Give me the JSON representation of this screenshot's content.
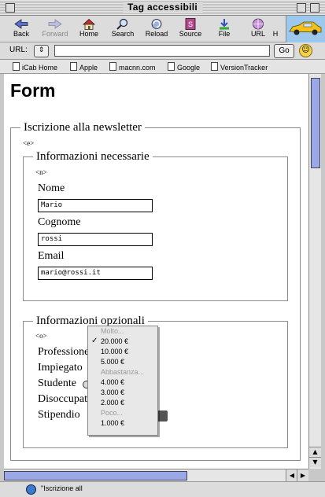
{
  "window": {
    "title": "Tag accessibili"
  },
  "toolbar": {
    "buttons": [
      {
        "label": "Back",
        "icon": "back-arrow-icon"
      },
      {
        "label": "Forward",
        "icon": "forward-arrow-icon"
      },
      {
        "label": "Home",
        "icon": "home-icon"
      },
      {
        "label": "Search",
        "icon": "search-icon"
      },
      {
        "label": "Reload",
        "icon": "reload-icon"
      },
      {
        "label": "Source",
        "icon": "source-icon"
      },
      {
        "label": "File",
        "icon": "file-icon"
      },
      {
        "label": "URL",
        "icon": "url-icon"
      },
      {
        "label": "H",
        "icon": "history-icon"
      }
    ]
  },
  "urlbar": {
    "label": "URL:",
    "value": "",
    "go_label": "Go"
  },
  "bookmarks": [
    "iCab Home",
    "Apple",
    "macnn.com",
    "Google",
    "VersionTracker"
  ],
  "page": {
    "heading": "Form",
    "newsletter_legend": "Iscrizione alla newsletter",
    "tag_e": "<e>",
    "required_legend": "Informazioni necessarie",
    "tag_n": "<n>",
    "nome_label": "Nome",
    "nome_value": "Mario",
    "cognome_label": "Cognome",
    "cognome_value": "rossi",
    "email_label": "Email",
    "email_value": "mario@rossi.it",
    "optional_legend": "Informazioni opzionali",
    "tag_o": "<o>",
    "professione_label": "Professione",
    "impiegato_label": "Impiegato",
    "studente_label": "Studente",
    "disoccupato_label": "Disoccupato",
    "stipendio_label": "Stipendio"
  },
  "dropdown": {
    "items": [
      {
        "text": "Molto...",
        "group": true,
        "checked": false
      },
      {
        "text": "20.000 €",
        "group": false,
        "checked": true
      },
      {
        "text": "10.000 €",
        "group": false,
        "checked": false
      },
      {
        "text": "5.000 €",
        "group": false,
        "checked": false
      },
      {
        "text": "Abbastanza...",
        "group": true,
        "checked": false
      },
      {
        "text": "4.000 €",
        "group": false,
        "checked": false
      },
      {
        "text": "3.000 €",
        "group": false,
        "checked": false
      },
      {
        "text": "2.000 €",
        "group": false,
        "checked": false
      },
      {
        "text": "Poco...",
        "group": true,
        "checked": false
      },
      {
        "text": "1.000 €",
        "group": false,
        "checked": false
      }
    ]
  },
  "status": {
    "text": "\"Iscrizione all"
  }
}
